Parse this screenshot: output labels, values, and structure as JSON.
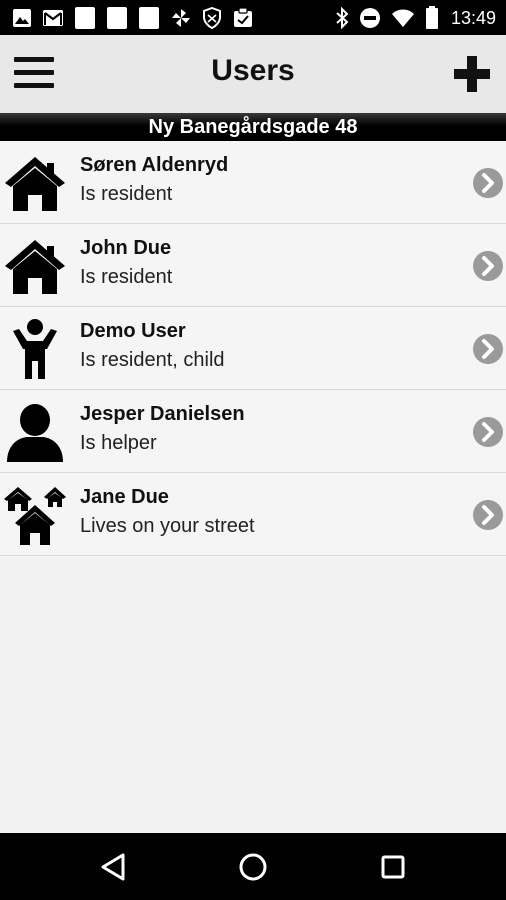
{
  "status_bar": {
    "time": "13:49",
    "left_icons": [
      "image-icon",
      "gmail-icon",
      "notification-square-icon",
      "notification-square-icon",
      "notification-square-icon",
      "pinwheel-icon",
      "shield-icon",
      "clipboard-icon"
    ],
    "right_icons": [
      "bluetooth-icon",
      "do-not-disturb-icon",
      "wifi-icon",
      "battery-icon"
    ]
  },
  "header": {
    "title": "Users",
    "menu_icon": "hamburger-menu-icon",
    "add_icon": "plus-icon"
  },
  "address": "Ny Banegårdsgade 48",
  "users": [
    {
      "name": "Søren Aldenryd",
      "status": "Is resident",
      "icon": "house-icon"
    },
    {
      "name": "John Due",
      "status": "Is resident",
      "icon": "house-icon"
    },
    {
      "name": "Demo User",
      "status": "Is resident, child",
      "icon": "child-icon"
    },
    {
      "name": "Jesper Danielsen",
      "status": "Is helper",
      "icon": "person-icon"
    },
    {
      "name": "Jane Due",
      "status": "Lives on your street",
      "icon": "houses-icon"
    }
  ],
  "nav": {
    "back_icon": "back-triangle-icon",
    "home_icon": "home-circle-icon",
    "recents_icon": "recents-square-icon"
  },
  "colors": {
    "status_bar": "#000000",
    "app_bar": "#e8e8e8",
    "list_background": "#f5f5f5",
    "chevron": "#9a9a9a"
  }
}
